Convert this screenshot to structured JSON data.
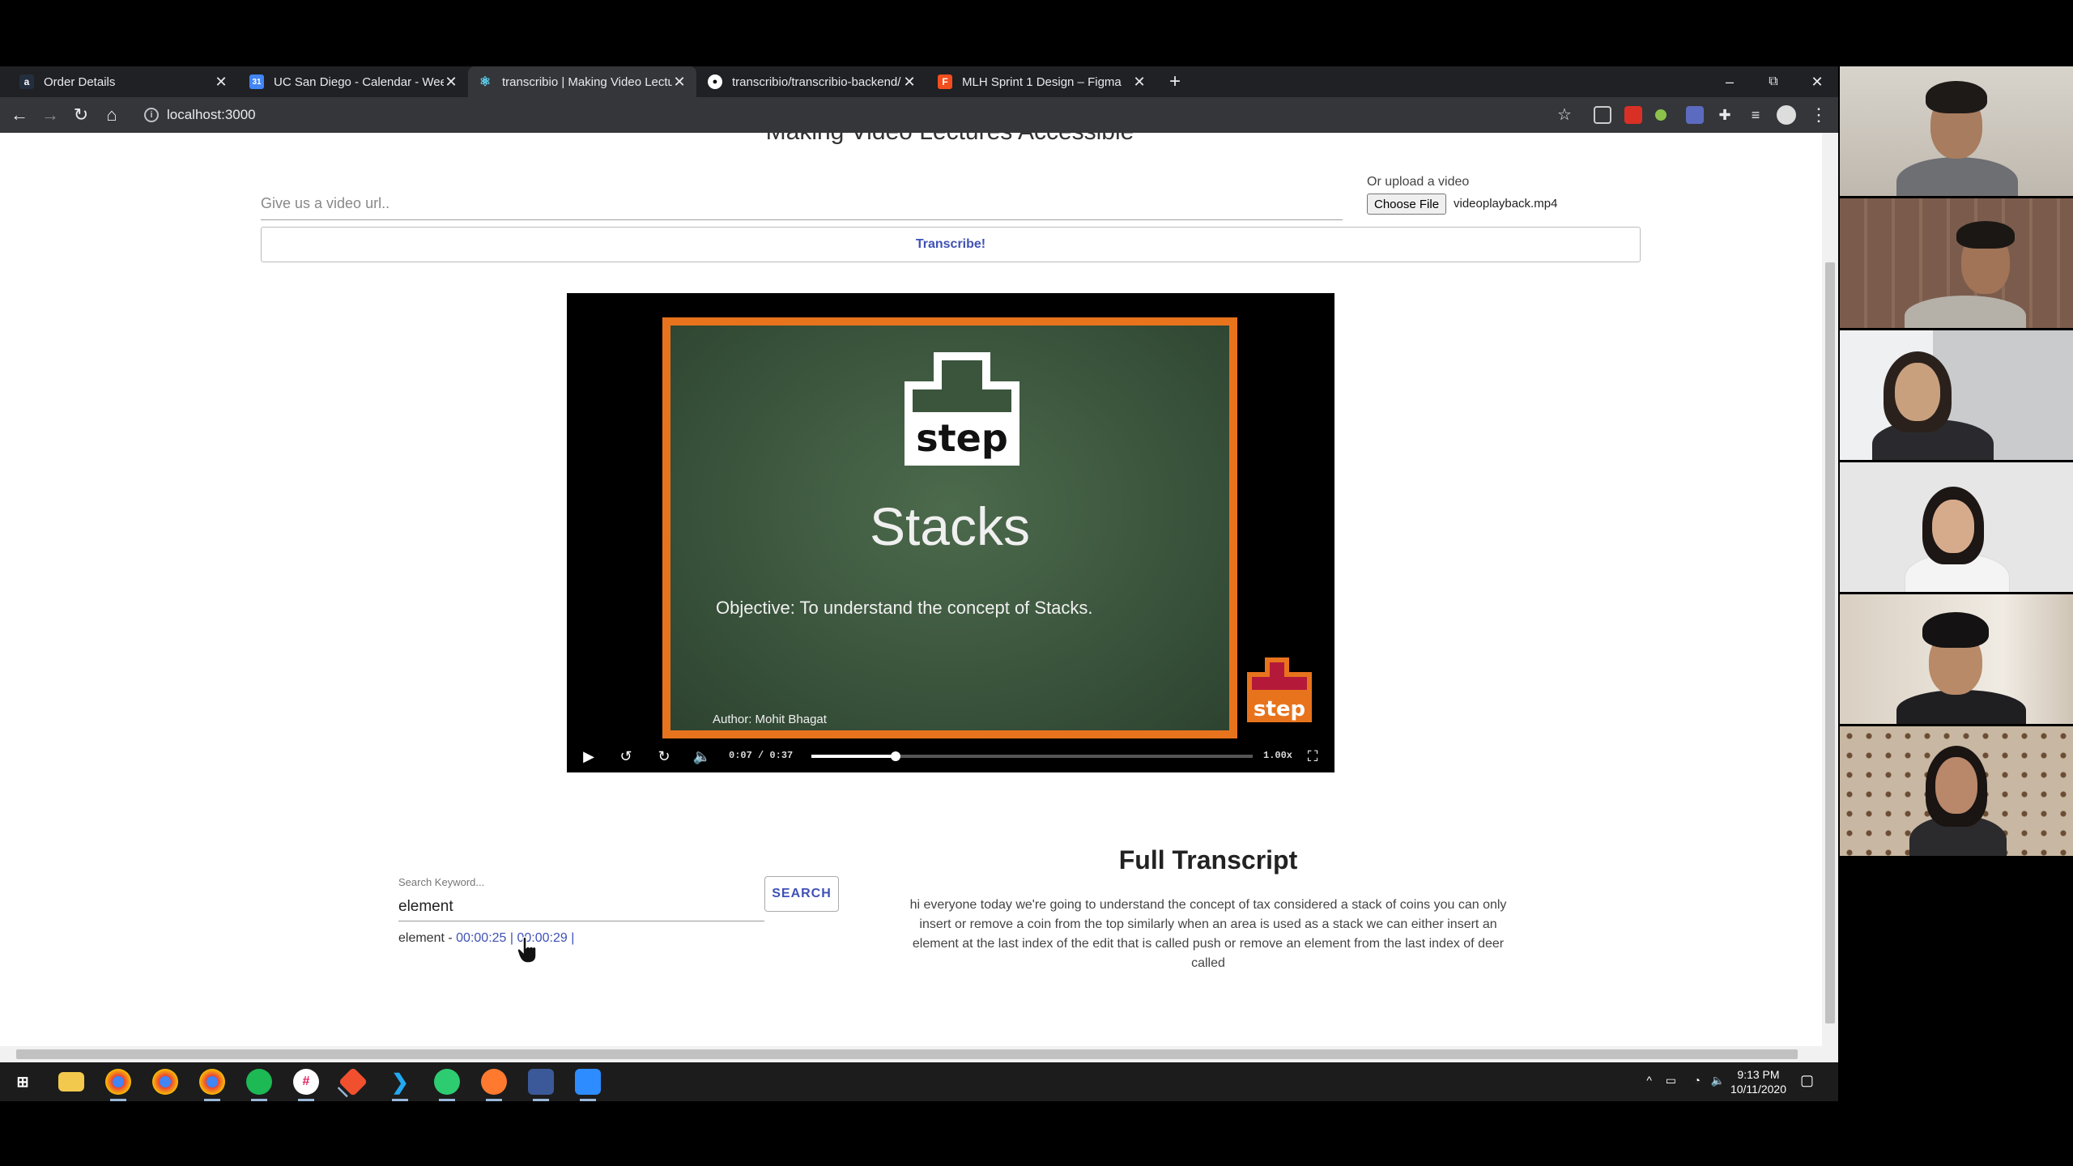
{
  "browser": {
    "tabs": [
      {
        "title": "Order Details",
        "icon": "amazon-icon",
        "color": "#232f3e",
        "glyph": "a"
      },
      {
        "title": "UC San Diego - Calendar - Week",
        "icon": "calendar-icon",
        "color": "#4285f4",
        "glyph": "31"
      },
      {
        "title": "transcribio | Making Video Lectur",
        "icon": "react-icon",
        "color": "#61dafb",
        "glyph": "⚛"
      },
      {
        "title": "transcribio/transcribio-backend/",
        "icon": "github-icon",
        "color": "#ffffff",
        "glyph": "●"
      },
      {
        "title": "MLH Sprint 1 Design – Figma",
        "icon": "figma-icon",
        "color": "#f24e1e",
        "glyph": "F"
      }
    ],
    "active_tab": 2,
    "address": "localhost:3000"
  },
  "page": {
    "heading": "Making Video Lectures Accessible",
    "url_placeholder": "Give us a video url..",
    "upload_label": "Or upload a video",
    "choose_file_label": "Choose File",
    "file_name": "videoplayback.mp4",
    "transcribe_label": "Transcribe!"
  },
  "video": {
    "slide_logo_text": "step",
    "slide_title": "Stacks",
    "objective": "Objective:  To understand the concept of Stacks.",
    "author": "Author: Mohit Bhagat",
    "corner_logo_text": "step",
    "current_time": "0:07",
    "time_separator": "/",
    "duration": "0:37",
    "progress_fraction": 0.19,
    "speed": "1.00x"
  },
  "search": {
    "label": "Search Keyword...",
    "value": "element",
    "button_label": "SEARCH",
    "result_keyword": "element -",
    "timestamps": [
      "00:00:25 |",
      "00:00:29 |"
    ]
  },
  "transcript": {
    "title": "Full Transcript",
    "text": "hi everyone today we're going to understand the concept of tax considered a stack of coins you can only insert or remove a coin from the top similarly when an area is used as a stack we can either insert an element at the last index of the edit that is called push or remove an element from the last index of deer called"
  },
  "taskbar": {
    "time": "9:13 PM",
    "date": "10/11/2020"
  },
  "colors": {
    "accent": "#3f51b5",
    "slide_border": "#e8731d",
    "chalkboard": "#3b553d"
  }
}
